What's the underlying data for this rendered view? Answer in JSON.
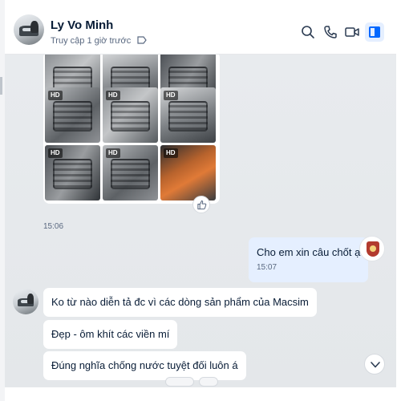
{
  "header": {
    "contact_name": "Ly Vo Minh",
    "status": "Truy cập 1 giờ trước",
    "icons": [
      "tag-icon",
      "search-icon",
      "phone-icon",
      "video-call-icon",
      "side-panel-icon"
    ]
  },
  "media_message": {
    "photos": [
      {
        "badge": ""
      },
      {
        "badge": ""
      },
      {
        "badge": ""
      },
      {
        "badge": "HD"
      },
      {
        "badge": "HD"
      },
      {
        "badge": "HD"
      },
      {
        "badge": "HD"
      },
      {
        "badge": "HD"
      },
      {
        "badge": "HD"
      }
    ],
    "time": "15:06"
  },
  "messages": [
    {
      "side": "outgoing",
      "text": "Cho em xin câu chốt ạ",
      "time": "15:07"
    },
    {
      "side": "incoming",
      "text": "Ko từ nào diễn tả đc vì các dòng sản phẩm của Macsim"
    },
    {
      "side": "incoming",
      "text": "Đẹp - ôm khít các viền mí"
    },
    {
      "side": "incoming",
      "text": "Đúng nghĩa chống nước tuyệt đối luôn á"
    }
  ],
  "colors": {
    "accent": "#0068ff",
    "outgoing_bubble": "#e5efff",
    "incoming_bubble": "#ffffff",
    "chat_background": "#e6e9ec"
  }
}
